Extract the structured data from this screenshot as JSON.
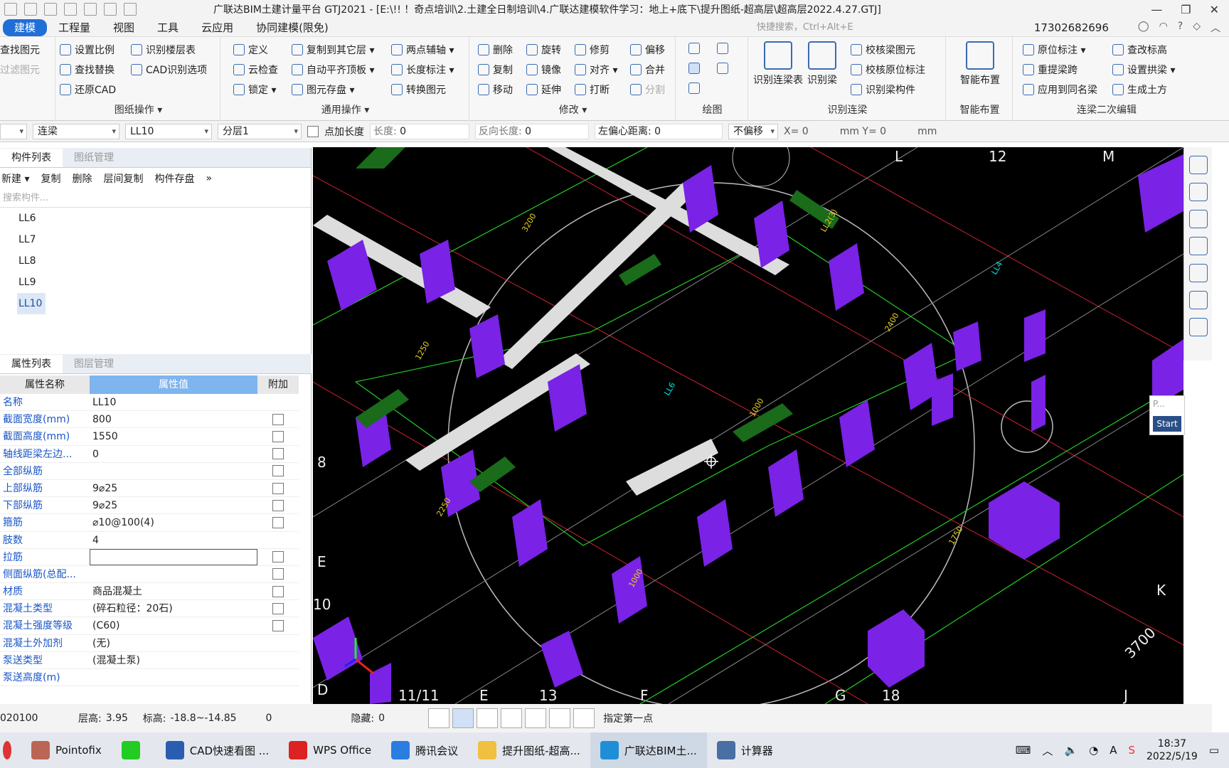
{
  "app": {
    "title": "广联达BIM土建计量平台 GTJ2021 - [E:\\!! ！奇点培训\\2.土建全日制培训\\4.广联达建模软件学习：地上+底下\\提升图纸-超高层\\超高层2022.4.27.GTJ]"
  },
  "menu": {
    "tabs": [
      "建模",
      "工程量",
      "视图",
      "工具",
      "云应用",
      "协同建模(限免)"
    ],
    "search_placeholder": "快捷搜索，Ctrl+Alt+E",
    "phone": "17302682696"
  },
  "ribbon": {
    "left_cut": [
      "查找图元",
      "过滤图元"
    ],
    "g1": {
      "name": "图纸操作 ▾",
      "items": [
        "设置比例",
        "识别楼层表",
        "查找替换",
        "CAD识别选项",
        "还原CAD"
      ]
    },
    "g2": {
      "name": "通用操作 ▾",
      "items": [
        "定义",
        "复制到其它层 ▾",
        "两点辅轴 ▾",
        "云检查",
        "自动平齐顶板 ▾",
        "长度标注 ▾",
        "锁定 ▾",
        "图元存盘 ▾",
        "转换图元"
      ]
    },
    "g3": {
      "name": "修改 ▾",
      "items": [
        "删除",
        "旋转",
        "修剪",
        "偏移",
        "复制",
        "镜像",
        "对齐 ▾",
        "合并",
        "移动",
        "延伸",
        "打断",
        "分割"
      ]
    },
    "g4": {
      "name": "绘图"
    },
    "g5": {
      "name": "识别连梁",
      "big": [
        "识别连梁表",
        "识别梁"
      ],
      "items": [
        "校核梁图元",
        "校核原位标注",
        "识别梁构件"
      ]
    },
    "g6": {
      "name": "智能布置",
      "big": "智能布置"
    },
    "g7": {
      "name": "连梁二次编辑",
      "items": [
        "原位标注 ▾",
        "查改标高",
        "重提梁跨",
        "设置拱梁 ▾",
        "应用到同名梁",
        "生成土方"
      ]
    }
  },
  "propbar": {
    "type": "连梁",
    "name": "LL10",
    "layer": "分层1",
    "point_len_label": "点加长度",
    "len_label": "长度:",
    "len_value": "0",
    "rev_label": "反向长度:",
    "rev_value": "0",
    "offset_label": "左偏心距离:",
    "offset_value": "0",
    "shift": "不偏移",
    "x": "X= 0",
    "y": "mm Y= 0",
    "unit": "mm"
  },
  "left": {
    "tabs1": [
      "构件列表",
      "图纸管理"
    ],
    "tools": [
      "新建 ▾",
      "复制",
      "删除",
      "层间复制",
      "构件存盘",
      "»"
    ],
    "search_placeholder": "搜索构件...",
    "components": [
      "LL6",
      "LL7",
      "LL8",
      "LL9",
      "LL10"
    ],
    "tabs2": [
      "属性列表",
      "图层管理"
    ],
    "headers": [
      "属性名称",
      "属性值",
      "附加"
    ],
    "props": [
      {
        "name": "名称",
        "value": "LL10",
        "check": false
      },
      {
        "name": "截面宽度(mm)",
        "value": "800",
        "check": true
      },
      {
        "name": "截面高度(mm)",
        "value": "1550",
        "check": true
      },
      {
        "name": "轴线距梁左边...",
        "value": "0",
        "check": true
      },
      {
        "name": "全部纵筋",
        "value": "",
        "check": true
      },
      {
        "name": "上部纵筋",
        "value": "9⌀25",
        "check": true
      },
      {
        "name": "下部纵筋",
        "value": "9⌀25",
        "check": true
      },
      {
        "name": "箍筋",
        "value": "⌀10@100(4)",
        "check": true
      },
      {
        "name": "肢数",
        "value": "4",
        "check": false
      },
      {
        "name": "拉筋",
        "value": "",
        "check": true
      },
      {
        "name": "侧面纵筋(总配...",
        "value": "",
        "check": true
      },
      {
        "name": "材质",
        "value": "商品混凝土",
        "check": true
      },
      {
        "name": "混凝土类型",
        "value": "(碎石粒径：20石)",
        "check": true
      },
      {
        "name": "混凝土强度等级",
        "value": "(C60)",
        "check": true
      },
      {
        "name": "混凝土外加剂",
        "value": "(无)",
        "check": false
      },
      {
        "name": "泵送类型",
        "value": "(混凝土泵)",
        "check": false
      },
      {
        "name": "泵送高度(m)",
        "value": "",
        "check": false
      }
    ]
  },
  "canvas": {
    "axis_labels": [
      "L",
      "12",
      "M",
      "8",
      "E",
      "10",
      "D",
      "11/11",
      "E",
      "13",
      "F",
      "G",
      "18",
      "J",
      "K",
      "3700"
    ],
    "popup_input": "P...",
    "popup_button": "Start"
  },
  "status": {
    "code": "020100",
    "floor_h_label": "层高:",
    "floor_h": "3.95",
    "elev_label": "标高:",
    "elev": "-18.8~-14.85",
    "zero": "0",
    "hidden_label": "隐藏:",
    "hidden": "0",
    "prompt": "指定第一点"
  },
  "taskbar": {
    "apps": [
      "Pointofix",
      "",
      "CAD快速看图 ...",
      "WPS Office",
      "腾讯会议",
      "提升图纸-超高...",
      "广联达BIM土...",
      "计算器"
    ],
    "time": "18:37",
    "date": "2022/5/19"
  }
}
